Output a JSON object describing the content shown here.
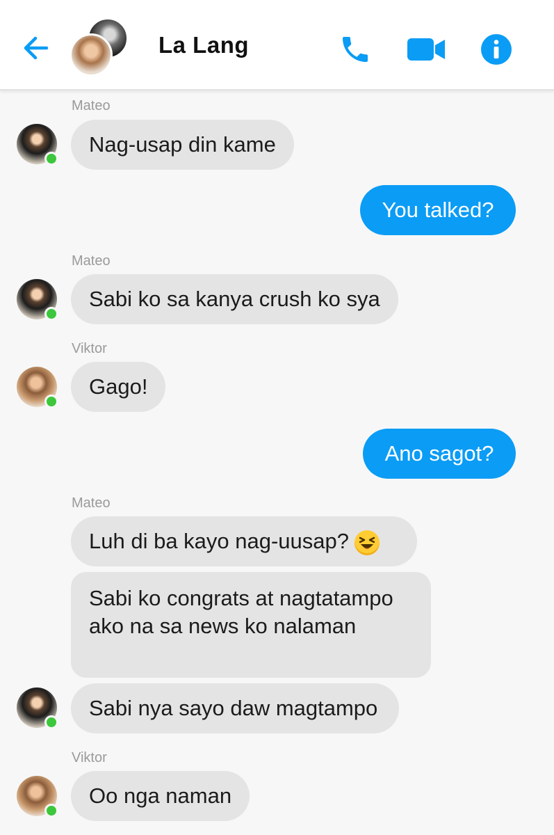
{
  "header": {
    "title": "La Lang",
    "back_icon": "arrow-left-icon",
    "call_icon": "phone-icon",
    "video_icon": "video-camera-icon",
    "info_icon": "info-icon",
    "accent_color": "#0b9cf5"
  },
  "messages": [
    {
      "sender": "Mateo",
      "text": "Nag-usap din kame",
      "from_me": false
    },
    {
      "sender": "",
      "text": "You talked?",
      "from_me": true
    },
    {
      "sender": "Mateo",
      "text": "Sabi ko sa kanya crush ko sya",
      "from_me": false
    },
    {
      "sender": "Viktor",
      "text": "Gago!",
      "from_me": false
    },
    {
      "sender": "",
      "text": "Ano sagot?",
      "from_me": true
    },
    {
      "sender": "Mateo",
      "text": "Luh di ba kayo nag-uusap?",
      "emoji": "grinning-squinting-face-emoji",
      "from_me": false
    },
    {
      "sender": "",
      "text": "Sabi ko congrats at nagtatampo ako na sa news ko nalaman",
      "from_me": false
    },
    {
      "sender": "",
      "text": "Sabi nya sayo daw magtampo",
      "from_me": false
    },
    {
      "sender": "Viktor",
      "text": "Oo nga naman",
      "from_me": false
    }
  ],
  "colors": {
    "my_bubble": "#0b9cf5",
    "their_bubble": "#e4e4e4",
    "online_dot": "#3cc73c"
  }
}
